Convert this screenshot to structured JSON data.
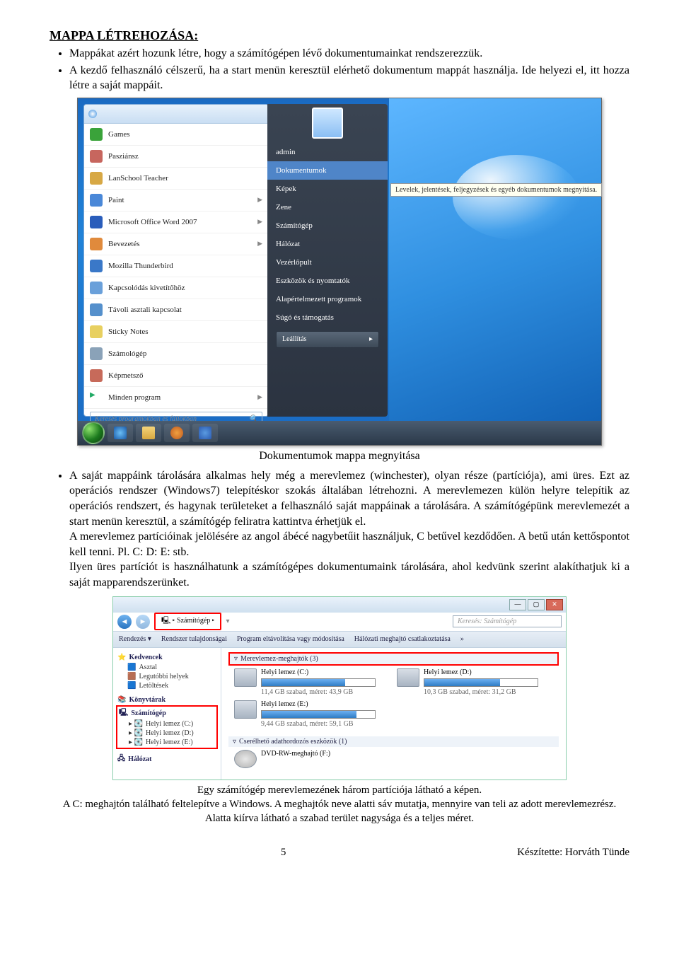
{
  "heading": "MAPPA LÉTREHOZÁSA:",
  "intro": [
    "Mappákat azért hozunk létre, hogy a számítógépen lévő dokumentumainkat rendszerezzük.",
    "A kezdő felhasználó célszerű, ha a start menün keresztül elérhető dokumentum mappát használja. Ide helyezi el, itt hozza létre a saját mappáit."
  ],
  "start_left": [
    {
      "label": "Games",
      "color": "#3aa33a"
    },
    {
      "label": "Pasziánsz",
      "color": "#c7665e"
    },
    {
      "label": "LanSchool Teacher",
      "color": "#d7a845"
    },
    {
      "label": "Paint",
      "color": "#4a88d8",
      "chev": true
    },
    {
      "label": "Microsoft Office Word 2007",
      "color": "#2a5dbb",
      "chev": true
    },
    {
      "label": "Bevezetés",
      "color": "#e08a3c",
      "chev": true
    },
    {
      "label": "Mozilla Thunderbird",
      "color": "#3a78c8"
    },
    {
      "label": "Kapcsolódás kivetítőhöz",
      "color": "#6aa0da"
    },
    {
      "label": "Távoli asztali kapcsolat",
      "color": "#5590cc"
    },
    {
      "label": "Sticky Notes",
      "color": "#e8d060"
    },
    {
      "label": "Számológép",
      "color": "#8aa2b8"
    },
    {
      "label": "Képmetsző",
      "color": "#c76a5a"
    },
    {
      "label": "Minden program",
      "color": "",
      "chev": true,
      "all": true
    }
  ],
  "search_placeholder": "Keresés programokban és fájlokban",
  "start_right": [
    "admin",
    "Dokumentumok",
    "Képek",
    "Zene",
    "Számítógép",
    "Hálózat",
    "Vezérlőpult",
    "Eszközök és nyomtatók",
    "Alapértelmezett programok",
    "Súgó és támogatás"
  ],
  "shutdown": "Leállítás",
  "tooltip": "Levelek, jelentések, feljegyzések és egyéb dokumentumok megnyitása.",
  "caption1": "Dokumentumok mappa megnyitása",
  "para2": [
    "A saját mappáink tárolására alkalmas hely még a merevlemez (winchester), olyan része (partíciója), ami üres. Ezt az operációs rendszer (Windows7) telepítéskor szokás általában létrehozni. A merevlemezen külön helyre telepítik az operációs rendszert, és hagynak területeket a felhasználó saját mappáinak a tárolására. A számítógépünk merevlemezét a start menün keresztül, a számítógép feliratra kattintva érhetjük el.",
    "A merevlemez partícióinak jelölésére az angol ábécé nagybetűit használjuk, C betűvel kezdődően. A betű után kettőspontot kell tenni. Pl. C: D: E: stb.",
    "Ilyen üres partíciót is használhatunk a számítógépes dokumentumaink tárolására, ahol kedvünk szerint alakíthatjuk ki a saját mapparendszerünket."
  ],
  "explorer": {
    "crumb": "Számítógép",
    "nav_search": "Keresés: Számítógép",
    "toolbar": [
      "Rendezés ▾",
      "Rendszer tulajdonságai",
      "Program eltávolítása vagy módosítása",
      "Hálózati meghajtó csatlakoztatása",
      "»"
    ],
    "side": {
      "fav": "Kedvencek",
      "fav_items": [
        "Asztal",
        "Legutóbbi helyek",
        "Letöltések"
      ],
      "lib": "Könyvtárak",
      "comp": "Számítógép",
      "comp_items": [
        "Helyi lemez (C:)",
        "Helyi lemez (D:)",
        "Helyi lemez (E:)"
      ],
      "net": "Hálózat"
    },
    "cat1": "Merevlemez-meghajtók (3)",
    "drives": [
      {
        "name": "Helyi lemez (C:)",
        "info": "11,4 GB szabad, méret: 43,9 GB",
        "fill": 74
      },
      {
        "name": "Helyi lemez (D:)",
        "info": "10,3 GB szabad, méret: 31,2 GB",
        "fill": 67
      },
      {
        "name": "Helyi lemez (E:)",
        "info": "9,44 GB szabad, méret: 59,1 GB",
        "fill": 84
      }
    ],
    "cat2": "Cserélhető adathordozós eszközök (1)",
    "dvd": "DVD-RW-meghajtó (F:)"
  },
  "caption2": [
    "Egy számítógép merevlemezének három partíciója látható a képen.",
    "A C: meghajtón található feltelepítve a Windows. A meghajtók neve alatti sáv mutatja, mennyire van teli az adott merevlemezrész. Alatta kiírva látható a szabad terület nagysága és a teljes méret."
  ],
  "footer": {
    "page": "5",
    "credit": "Készítette: Horváth Tünde"
  }
}
